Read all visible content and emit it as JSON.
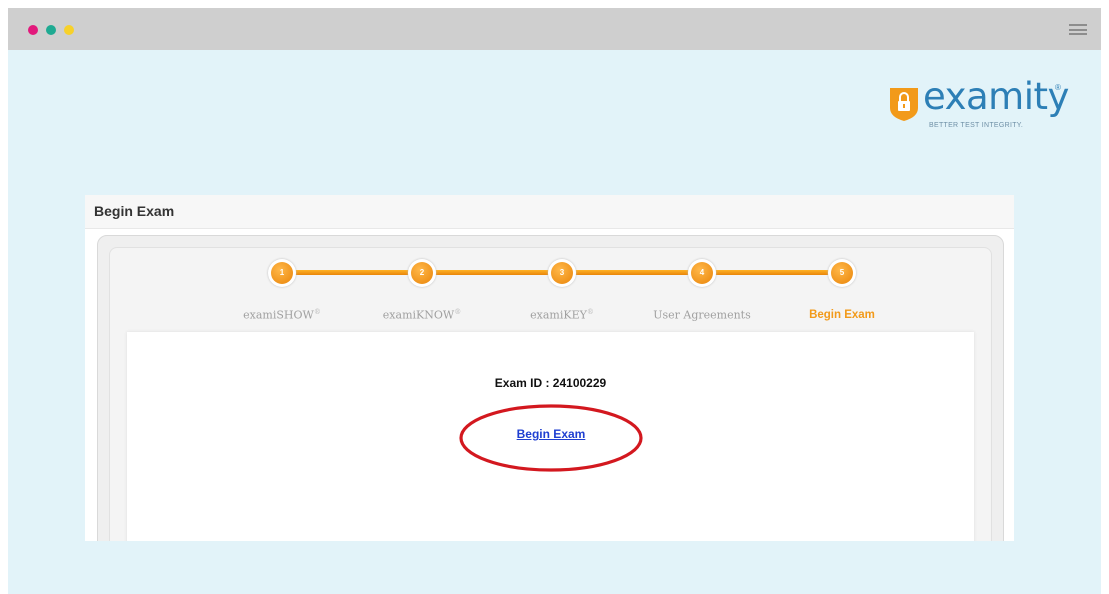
{
  "window": {
    "dot_colors": [
      "#e2197c",
      "#1faa92",
      "#f7d12a"
    ]
  },
  "logo": {
    "brand": "examity",
    "reg": "®",
    "tagline": "BETTER TEST INTEGRITY."
  },
  "panel": {
    "title": "Begin Exam"
  },
  "steps": [
    {
      "number": "1",
      "label": "examiSHOW",
      "mark": "®"
    },
    {
      "number": "2",
      "label": "examiKNOW",
      "mark": "®"
    },
    {
      "number": "3",
      "label": "examiKEY",
      "mark": "®"
    },
    {
      "number": "4",
      "label": "User Agreements",
      "mark": ""
    },
    {
      "number": "5",
      "label": "Begin Exam",
      "mark": ""
    }
  ],
  "active_step": 5,
  "content": {
    "exam_id": "Exam ID : 24100229",
    "begin_link": "Begin Exam"
  },
  "colors": {
    "accent_orange": "#f29a1a",
    "link_blue": "#1f3fd1",
    "annotation_red": "#d3181f",
    "brand_blue": "#2d7fb6"
  }
}
